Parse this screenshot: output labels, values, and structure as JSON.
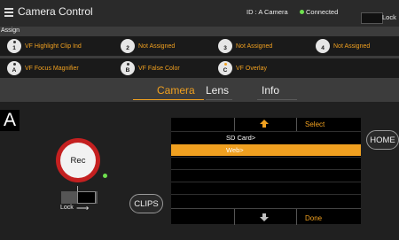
{
  "header": {
    "title": "Camera Control",
    "camera_id": "ID : A Camera",
    "connection_status": "Connected",
    "lock_label": "Lock"
  },
  "assign": {
    "label": "Assign",
    "row1": [
      {
        "badge": "1",
        "label": "VF Highlight Clip Ind"
      },
      {
        "badge": "2",
        "label": "Not Assigned"
      },
      {
        "badge": "3",
        "label": "Not Assigned"
      },
      {
        "badge": "4",
        "label": "Not Assigned"
      }
    ],
    "row2": [
      {
        "badge": "A",
        "label": "VF Focus Magnifier"
      },
      {
        "badge": "B",
        "label": "VF False Color"
      },
      {
        "badge": "C",
        "label": "VF Overlay"
      }
    ]
  },
  "tabs": [
    {
      "label": "Camera",
      "active": true
    },
    {
      "label": "Lens",
      "active": false
    },
    {
      "label": "Info",
      "active": false
    }
  ],
  "control": {
    "camera_letter": "A",
    "rec_label": "Rec",
    "lock_label": "Lock",
    "clips_label": "CLIPS",
    "home_label": "HOME"
  },
  "menu": {
    "select_label": "Select",
    "done_label": "Done",
    "items": [
      "SD Card>",
      "Web>",
      "",
      "",
      "",
      "",
      ""
    ]
  },
  "colors": {
    "accent": "#f0a020",
    "rec": "#c42020",
    "connected": "#6ee04e"
  }
}
